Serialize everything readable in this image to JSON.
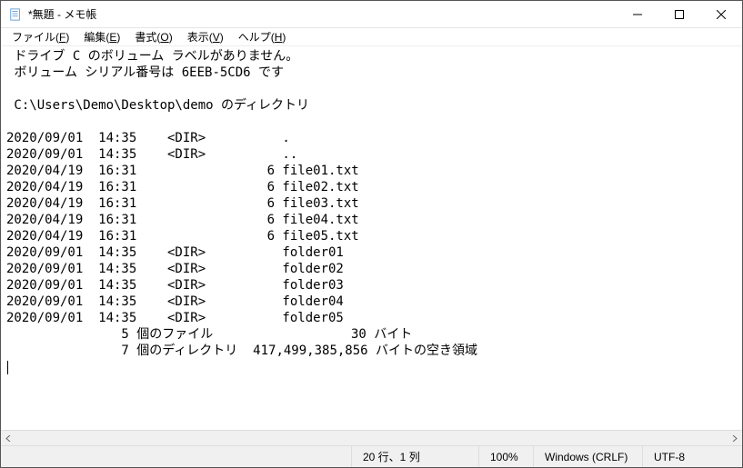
{
  "window": {
    "title": "*無題 - メモ帳"
  },
  "menus": {
    "file": {
      "label": "ファイル",
      "accel": "F"
    },
    "edit": {
      "label": "編集",
      "accel": "E"
    },
    "format": {
      "label": "書式",
      "accel": "O"
    },
    "view": {
      "label": "表示",
      "accel": "V"
    },
    "help": {
      "label": "ヘルプ",
      "accel": "H"
    }
  },
  "content": {
    "lines": [
      " ドライブ C のボリューム ラベルがありません。",
      " ボリューム シリアル番号は 6EEB-5CD6 です",
      "",
      " C:\\Users\\Demo\\Desktop\\demo のディレクトリ",
      "",
      "2020/09/01  14:35    <DIR>          .",
      "2020/09/01  14:35    <DIR>          ..",
      "2020/04/19  16:31                 6 file01.txt",
      "2020/04/19  16:31                 6 file02.txt",
      "2020/04/19  16:31                 6 file03.txt",
      "2020/04/19  16:31                 6 file04.txt",
      "2020/04/19  16:31                 6 file05.txt",
      "2020/09/01  14:35    <DIR>          folder01",
      "2020/09/01  14:35    <DIR>          folder02",
      "2020/09/01  14:35    <DIR>          folder03",
      "2020/09/01  14:35    <DIR>          folder04",
      "2020/09/01  14:35    <DIR>          folder05",
      "               5 個のファイル                  30 バイト",
      "               7 個のディレクトリ  417,499,385,856 バイトの空き領域"
    ]
  },
  "statusbar": {
    "position": "20 行、1 列",
    "zoom": "100%",
    "eol": "Windows (CRLF)",
    "encoding": "UTF-8"
  }
}
